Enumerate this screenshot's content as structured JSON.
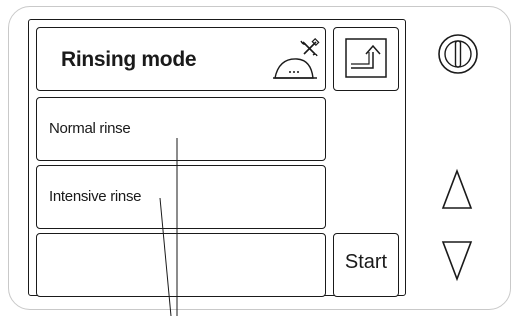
{
  "header": {
    "title": "Rinsing mode",
    "settings_icon": "wrench-screwdriver-salt-icon",
    "back_icon": "return-arrow-icon"
  },
  "options": [
    {
      "label": "Normal rinse"
    },
    {
      "label": "Intensive rinse"
    },
    {
      "label": ""
    }
  ],
  "actions": {
    "start_label": "Start"
  },
  "hardware": {
    "power_icon": "power-icon",
    "up_icon": "triangle-up-icon",
    "down_icon": "triangle-down-icon"
  }
}
